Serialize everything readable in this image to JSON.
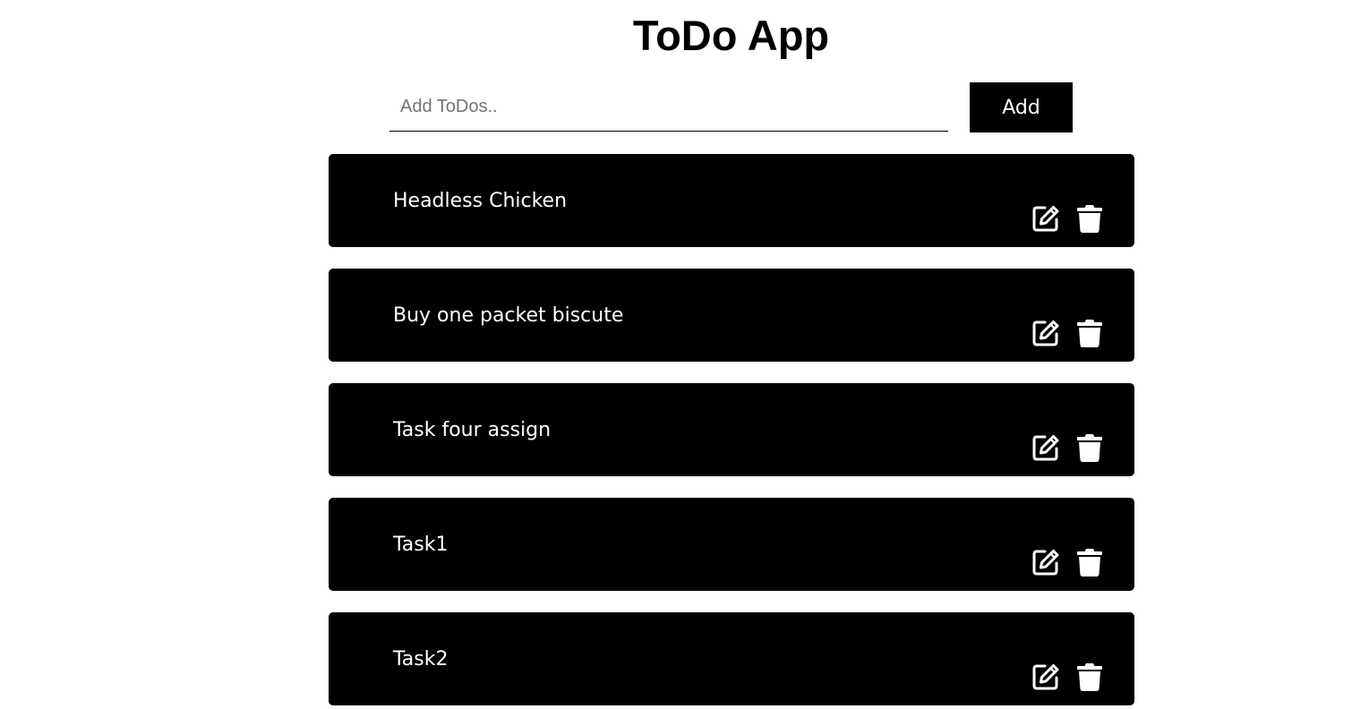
{
  "app": {
    "title": "ToDo App"
  },
  "add_form": {
    "input_value": "",
    "input_placeholder": "Add ToDos..",
    "add_label": "Add"
  },
  "todos": [
    {
      "text": "Headless Chicken"
    },
    {
      "text": "Buy one packet biscute"
    },
    {
      "text": "Task four assign"
    },
    {
      "text": "Task1"
    },
    {
      "text": "Task2"
    }
  ],
  "icons": {
    "edit": "edit-icon",
    "delete": "trash-icon"
  },
  "colors": {
    "background": "#ffffff",
    "card": "#000000",
    "card_text": "#ffffff",
    "button": "#000000",
    "placeholder": "#757575"
  }
}
